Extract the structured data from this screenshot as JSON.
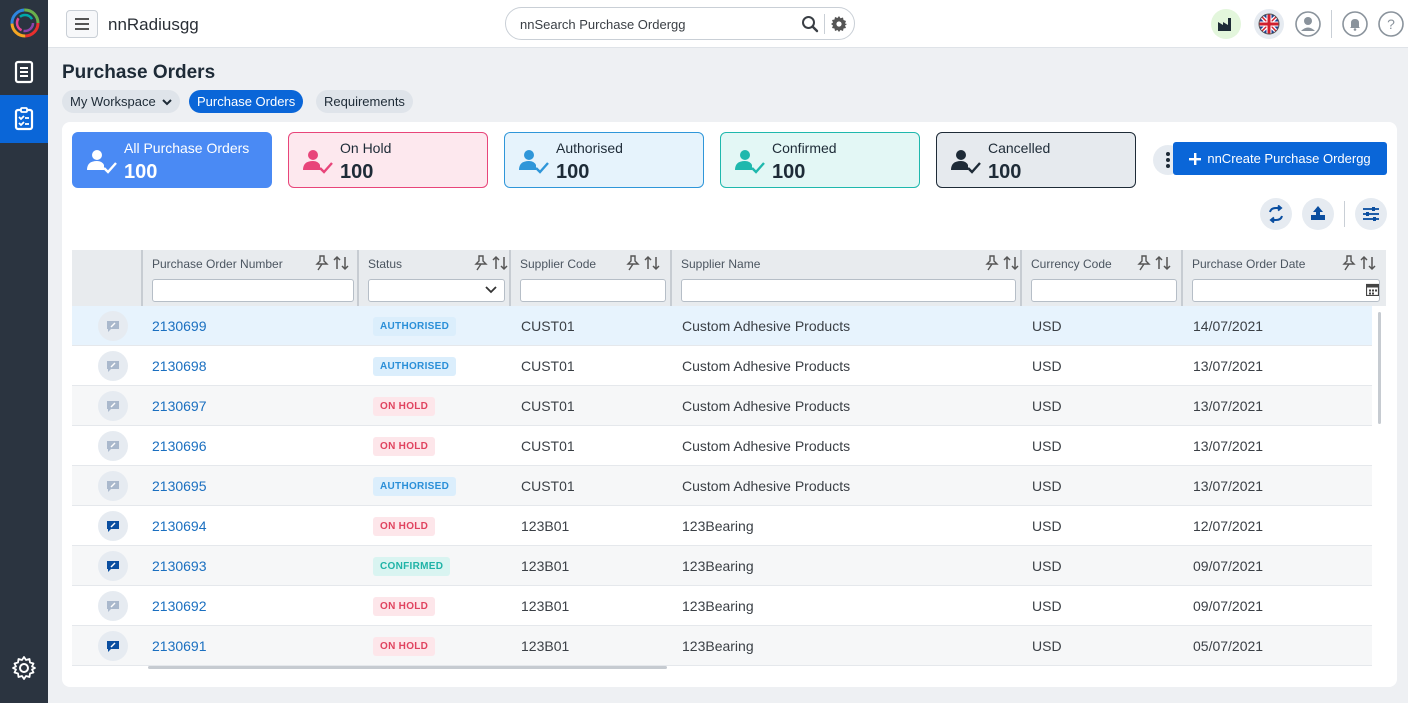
{
  "app": {
    "title": "nnRadiusgg",
    "search_placeholder": "nnSearch Purchase Ordergg"
  },
  "rail": {
    "items": [
      "documents-icon",
      "checklist-icon"
    ],
    "active_item": "checklist-icon",
    "bottom_item": "settings-icon"
  },
  "topbar_icons": [
    "factory-icon",
    "uk-flag-icon",
    "user-avatar-icon",
    "bell-icon",
    "help-icon"
  ],
  "page": {
    "title": "Purchase Orders",
    "breadcrumbs": [
      {
        "label": "My Workspace",
        "dropdown": true
      },
      {
        "label": "Purchase Orders",
        "active": true
      },
      {
        "label": "Requirements"
      }
    ]
  },
  "tiles": [
    {
      "label": "All Purchase Orders",
      "count": "100",
      "style": "active",
      "color": "#4a8af4"
    },
    {
      "label": "On Hold",
      "count": "100",
      "color": "#e8457a"
    },
    {
      "label": "Authorised",
      "count": "100",
      "color": "#2f96d9"
    },
    {
      "label": "Confirmed",
      "count": "100",
      "color": "#1fb8ad"
    },
    {
      "label": "Cancelled",
      "count": "100",
      "color": "#1e2b37"
    }
  ],
  "create_button": {
    "label": "nnCreate Purchase Ordergg",
    "icon": "plus-icon"
  },
  "toolbar_icons": [
    "refresh-icon",
    "export-icon",
    "column-settings-icon"
  ],
  "grid": {
    "columns": [
      "Purchase Order Number",
      "Status",
      "Supplier Code",
      "Supplier Name",
      "Currency Code",
      "Purchase Order Date"
    ],
    "rows": [
      {
        "po": "2130699",
        "status": "AUTHORISED",
        "status_class": "authorised",
        "supplier_code": "CUST01",
        "supplier_name": "Custom Adhesive Products",
        "currency": "USD",
        "date": "14/07/2021",
        "has_message": false,
        "selected": true
      },
      {
        "po": "2130698",
        "status": "AUTHORISED",
        "status_class": "authorised",
        "supplier_code": "CUST01",
        "supplier_name": "Custom Adhesive Products",
        "currency": "USD",
        "date": "13/07/2021",
        "has_message": false
      },
      {
        "po": "2130697",
        "status": "ON HOLD",
        "status_class": "on-hold",
        "supplier_code": "CUST01",
        "supplier_name": "Custom Adhesive Products",
        "currency": "USD",
        "date": "13/07/2021",
        "has_message": false
      },
      {
        "po": "2130696",
        "status": "ON HOLD",
        "status_class": "on-hold",
        "supplier_code": "CUST01",
        "supplier_name": "Custom Adhesive Products",
        "currency": "USD",
        "date": "13/07/2021",
        "has_message": false
      },
      {
        "po": "2130695",
        "status": "AUTHORISED",
        "status_class": "authorised",
        "supplier_code": "CUST01",
        "supplier_name": "Custom Adhesive Products",
        "currency": "USD",
        "date": "13/07/2021",
        "has_message": false
      },
      {
        "po": "2130694",
        "status": "ON HOLD",
        "status_class": "on-hold",
        "supplier_code": "123B01",
        "supplier_name": "123Bearing",
        "currency": "USD",
        "date": "12/07/2021",
        "has_message": true
      },
      {
        "po": "2130693",
        "status": "CONFIRMED",
        "status_class": "confirmed",
        "supplier_code": "123B01",
        "supplier_name": "123Bearing",
        "currency": "USD",
        "date": "09/07/2021",
        "has_message": true
      },
      {
        "po": "2130692",
        "status": "ON HOLD",
        "status_class": "on-hold",
        "supplier_code": "123B01",
        "supplier_name": "123Bearing",
        "currency": "USD",
        "date": "09/07/2021",
        "has_message": false
      },
      {
        "po": "2130691",
        "status": "ON HOLD",
        "status_class": "on-hold",
        "supplier_code": "123B01",
        "supplier_name": "123Bearing",
        "currency": "USD",
        "date": "05/07/2021",
        "has_message": true
      }
    ]
  }
}
